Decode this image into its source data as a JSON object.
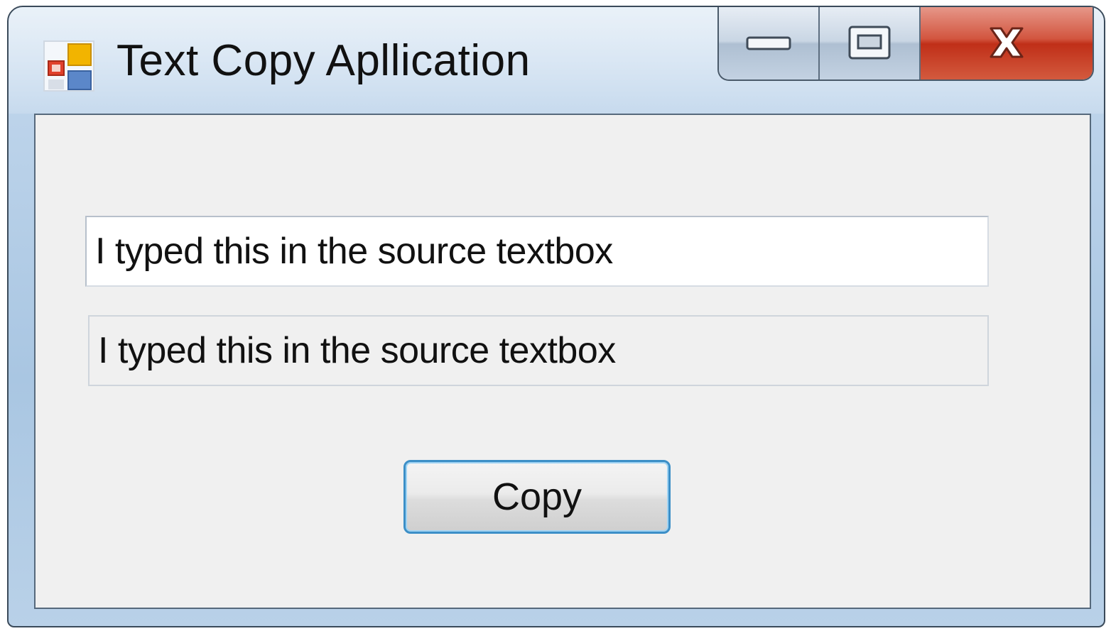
{
  "window": {
    "title": "Text Copy Apllication",
    "icon": "winforms-app-icon"
  },
  "caption_buttons": {
    "minimize_icon": "minimize-icon",
    "maximize_icon": "maximize-icon",
    "close_icon": "close-icon"
  },
  "form": {
    "source_textbox_value": "I typed this in the source textbox",
    "target_textbox_value": "I typed this in the source textbox",
    "copy_button_label": "Copy"
  },
  "colors": {
    "titlebar": "#bcd3ea",
    "client_background": "#f0f0f0",
    "close_button": "#c8432b",
    "button_focus_border": "#3c8fc7"
  }
}
